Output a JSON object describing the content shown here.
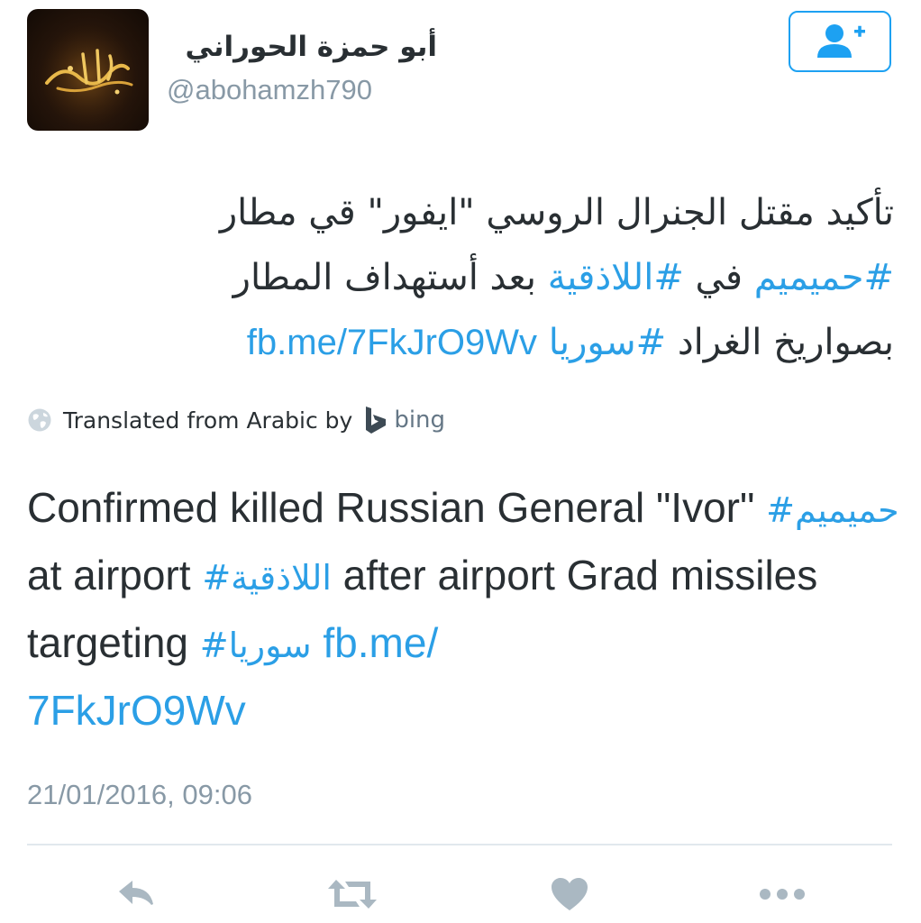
{
  "tweet": {
    "display_name": "أبو حمزة الحوراني",
    "handle": "@abohamzh790",
    "arabic_text": {
      "line1": "تأكيد مقتل الجنرال الروسي \"ايفور\" قي مطار",
      "line2_tag1": "#حميميم",
      "line2_mid": " في ",
      "line2_tag2": "#اللاذقية",
      "line2_end": " بعد أستهداف المطار",
      "line3_start": "بصواريخ الغراد ",
      "line3_tag": "#سوريا",
      "line3_link": "fb.me/7FkJrO9Wv"
    },
    "translation": {
      "label": "Translated from Arabic by",
      "provider": "bing"
    },
    "english_text": {
      "part1": "Confirmed killed Russian General \"Ivor\"",
      "tag1": "حميميم#",
      "part2": " at airport ",
      "tag2": "اللاذقية#",
      "part3": " after airport Grad missiles targeting ",
      "tag3": "سوريا#",
      "link_part1": "fb.me/",
      "link_part2": "7FkJrO9Wv"
    },
    "timestamp": "21/01/2016, 09:06"
  },
  "colors": {
    "link": "#2b9fe6",
    "text": "#292f33",
    "muted": "#8899a6",
    "action_icon": "#aab8c2",
    "divider": "#e1e8ed"
  },
  "icons": {
    "follow": "follow-user-icon",
    "reply": "reply-icon",
    "retweet": "retweet-icon",
    "like": "heart-icon",
    "more": "more-icon",
    "globe": "globe-icon",
    "bing": "bing-logo-icon"
  }
}
